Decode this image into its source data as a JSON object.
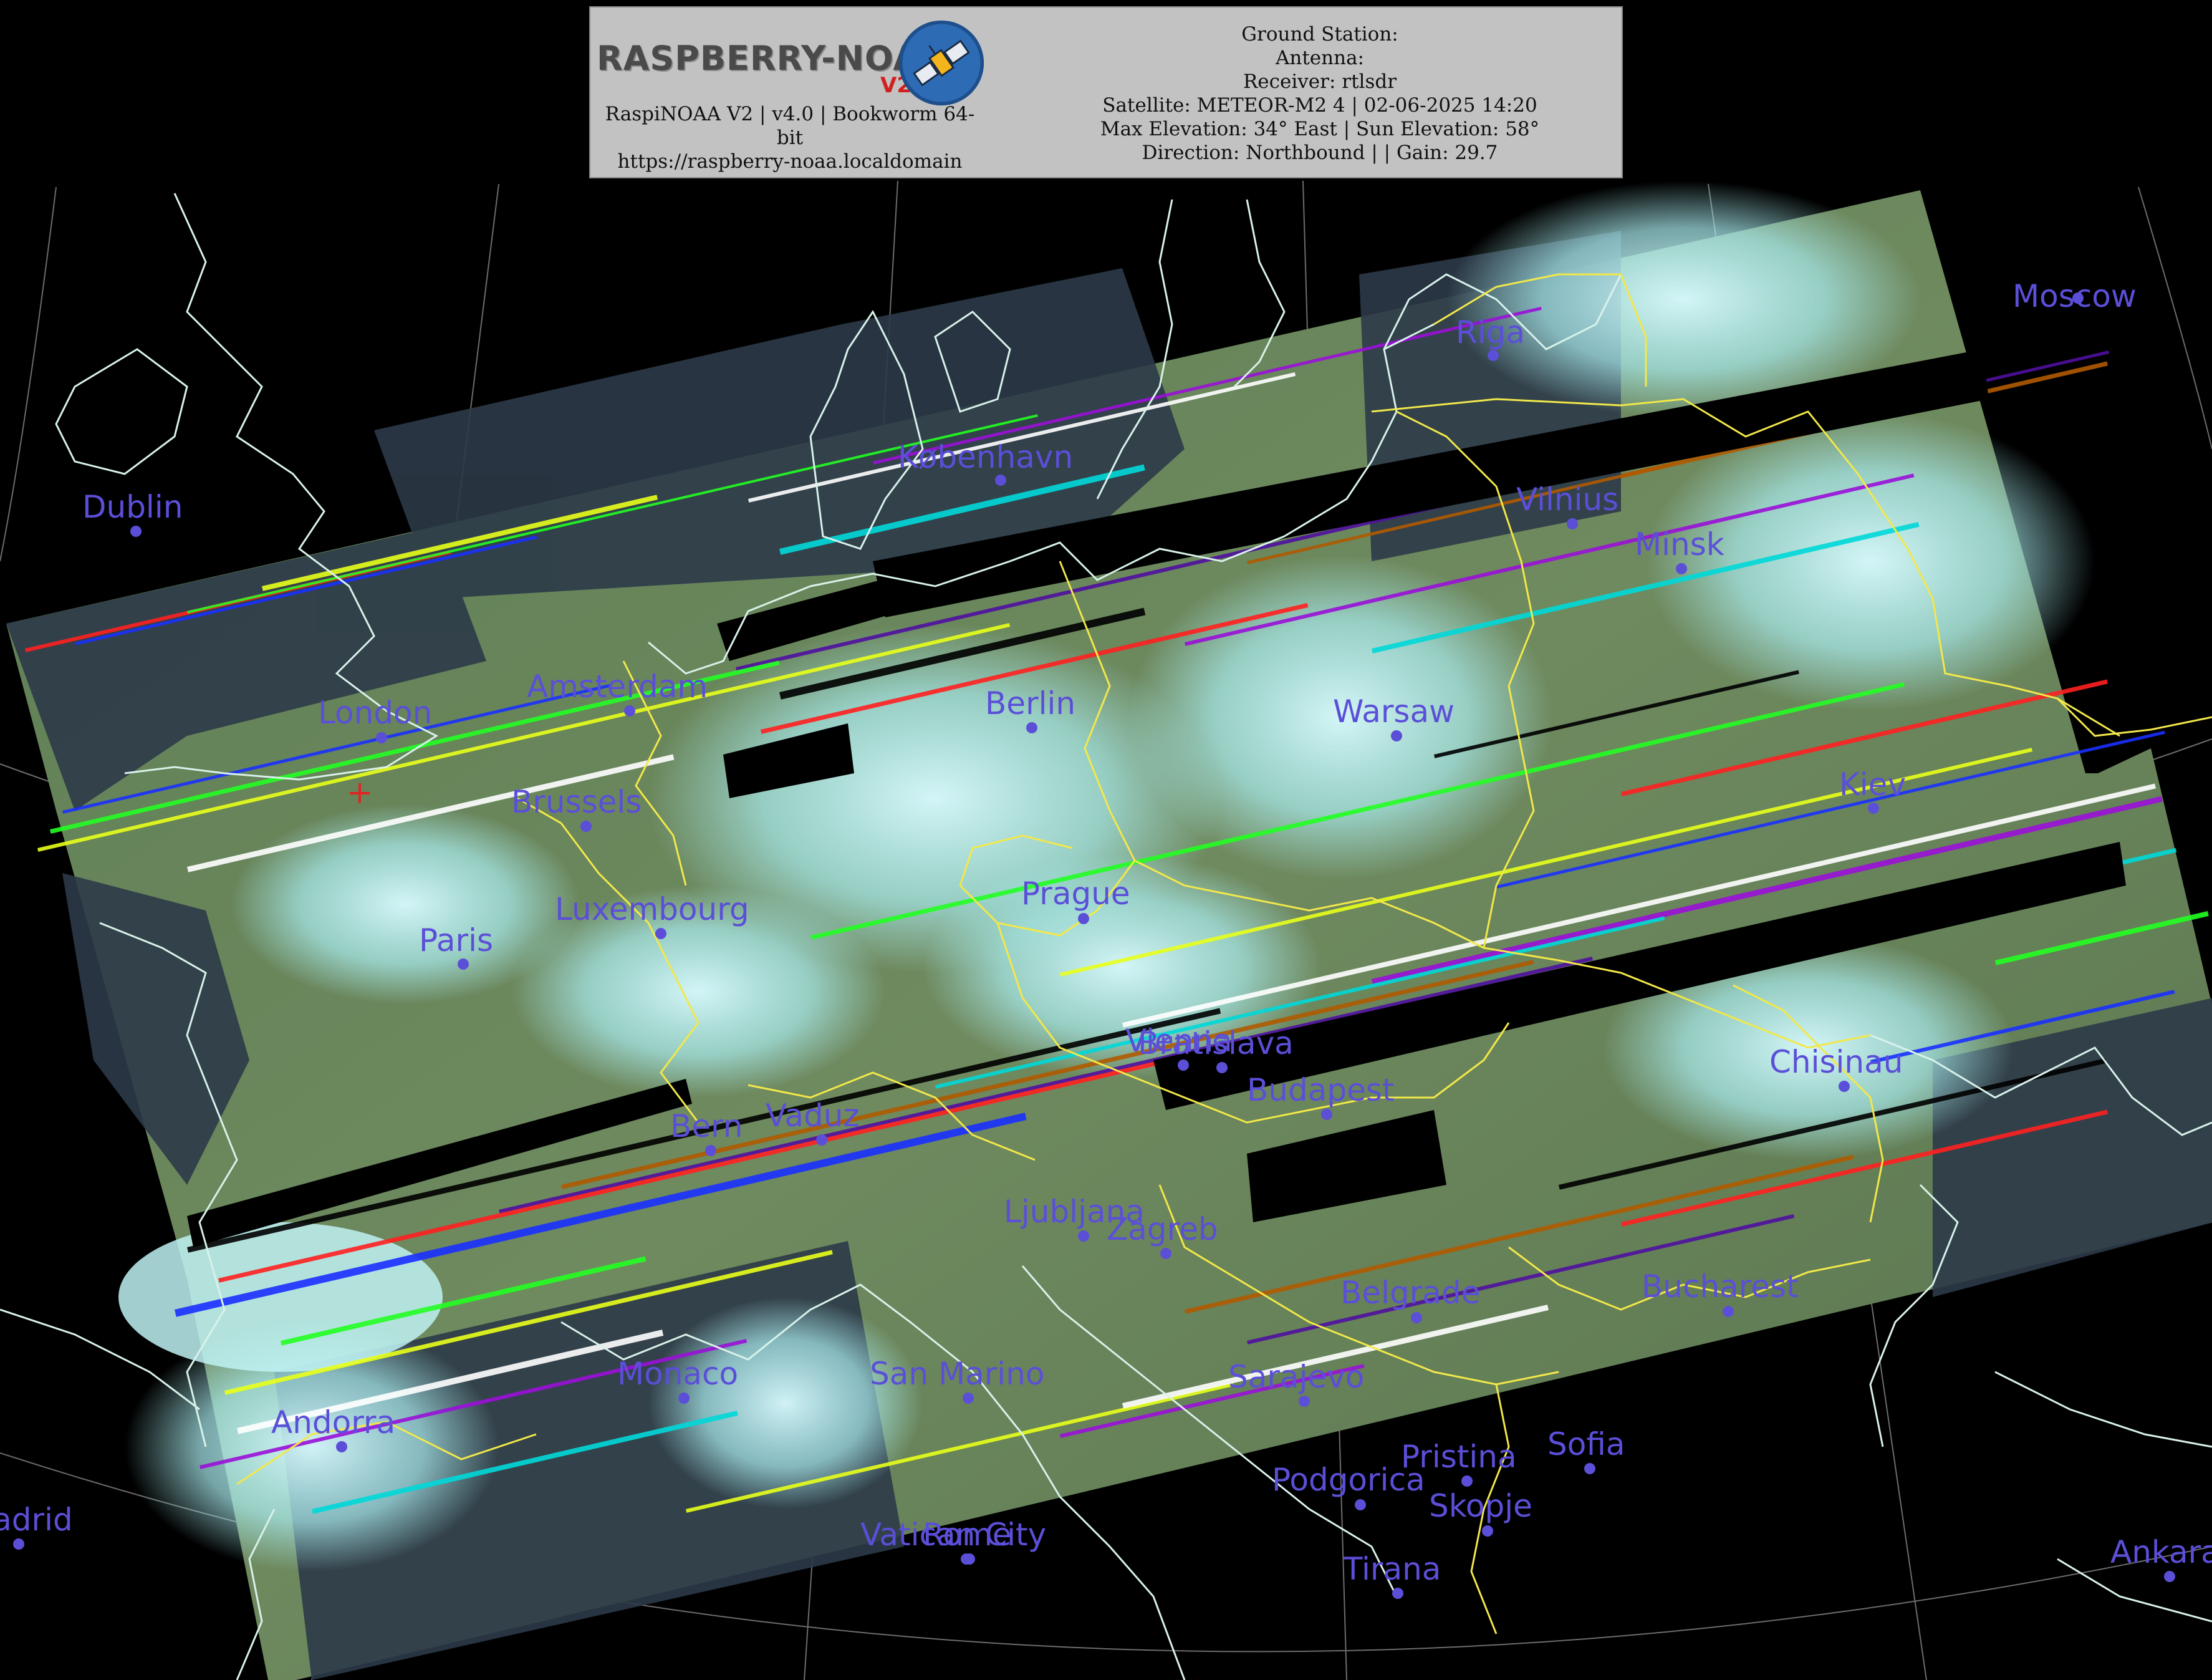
{
  "header": {
    "logo_text": "RASPBERRY-NOAA",
    "logo_version": "V2",
    "software": "RaspiNOAA V2 | v4.0 | Bookworm 64-bit",
    "url": "https://raspberry-noaa.localdomain",
    "ground_station": "Ground Station:",
    "antenna": "Antenna:",
    "receiver": "Receiver: rtlsdr",
    "satellite": "Satellite: METEOR-M2 4 | 02-06-2025 14:20",
    "elevation": "Max Elevation: 34° East | Sun Elevation: 58°",
    "direction": "Direction: Northbound | | Gain: 29.7"
  },
  "colors": {
    "background": "#000000",
    "coastline": "#d8f2ea",
    "borders": "#f2e84a",
    "city_label": "#5b4fd8",
    "header_bg": "#c2c2c2"
  },
  "cities": [
    {
      "name": "Moscow"
    },
    {
      "name": "Riga"
    },
    {
      "name": "København"
    },
    {
      "name": "Dublin"
    },
    {
      "name": "Vilnius"
    },
    {
      "name": "Minsk"
    },
    {
      "name": "Amsterdam"
    },
    {
      "name": "London"
    },
    {
      "name": "Berlin"
    },
    {
      "name": "Warsaw"
    },
    {
      "name": "Brussels"
    },
    {
      "name": "Kiev"
    },
    {
      "name": "Luxembourg"
    },
    {
      "name": "Prague"
    },
    {
      "name": "Paris"
    },
    {
      "name": "Vienna"
    },
    {
      "name": "Bratislava"
    },
    {
      "name": "Budapest"
    },
    {
      "name": "Chisinau"
    },
    {
      "name": "Bern"
    },
    {
      "name": "Vaduz"
    },
    {
      "name": "Ljubljana"
    },
    {
      "name": "Zagreb"
    },
    {
      "name": "Belgrade"
    },
    {
      "name": "Bucharest"
    },
    {
      "name": "Monaco"
    },
    {
      "name": "San Marino"
    },
    {
      "name": "Sarajevo"
    },
    {
      "name": "Andorra"
    },
    {
      "name": "Pristina"
    },
    {
      "name": "Sofia"
    },
    {
      "name": "Podgorica"
    },
    {
      "name": "Skopje"
    },
    {
      "name": "Madrid"
    },
    {
      "name": "Vatican City"
    },
    {
      "name": "Rome"
    },
    {
      "name": "Tirana"
    },
    {
      "name": "Ankara"
    }
  ]
}
